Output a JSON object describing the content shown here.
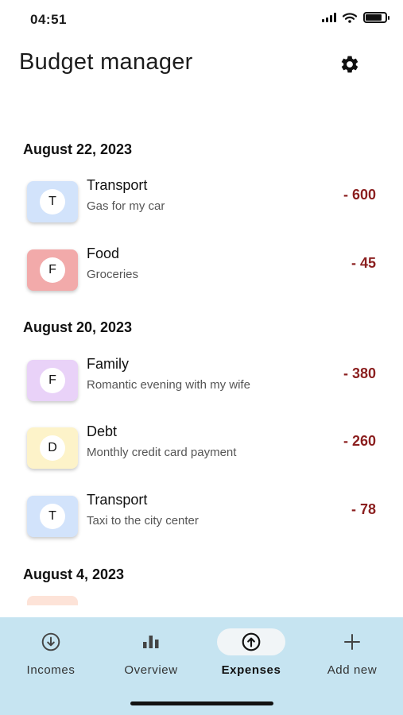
{
  "status": {
    "time": "04:51"
  },
  "header": {
    "title": "Budget manager",
    "settings_icon": "gear-icon"
  },
  "sections": [
    {
      "date": "August 22, 2023",
      "items": [
        {
          "initial": "T",
          "category": "Transport",
          "note": "Gas for my car",
          "amount": "- 600",
          "color": "#d2e3fb"
        },
        {
          "initial": "F",
          "category": "Food",
          "note": "Groceries",
          "amount": "- 45",
          "color": "#f2aaaa"
        }
      ]
    },
    {
      "date": "August 20, 2023",
      "items": [
        {
          "initial": "F",
          "category": "Family",
          "note": "Romantic evening with my wife",
          "amount": "- 380",
          "color": "#e9d2f8"
        },
        {
          "initial": "D",
          "category": "Debt",
          "note": "Monthly credit card payment",
          "amount": "- 260",
          "color": "#fdf3c9"
        },
        {
          "initial": "T",
          "category": "Transport",
          "note": "Taxi to the city center",
          "amount": "- 78",
          "color": "#d2e3fb"
        }
      ]
    },
    {
      "date": "August 4, 2023",
      "items": []
    }
  ],
  "nav": {
    "items": [
      {
        "label": "Incomes",
        "icon": "arrow-down-circle-icon"
      },
      {
        "label": "Overview",
        "icon": "bar-chart-icon"
      },
      {
        "label": "Expenses",
        "icon": "arrow-up-circle-icon",
        "active": true
      },
      {
        "label": "Add new",
        "icon": "plus-icon"
      }
    ]
  },
  "colors": {
    "amount": "#8b1f1f",
    "nav_bg": "#c6e4f1",
    "active_pill": "#f1f5f7"
  }
}
